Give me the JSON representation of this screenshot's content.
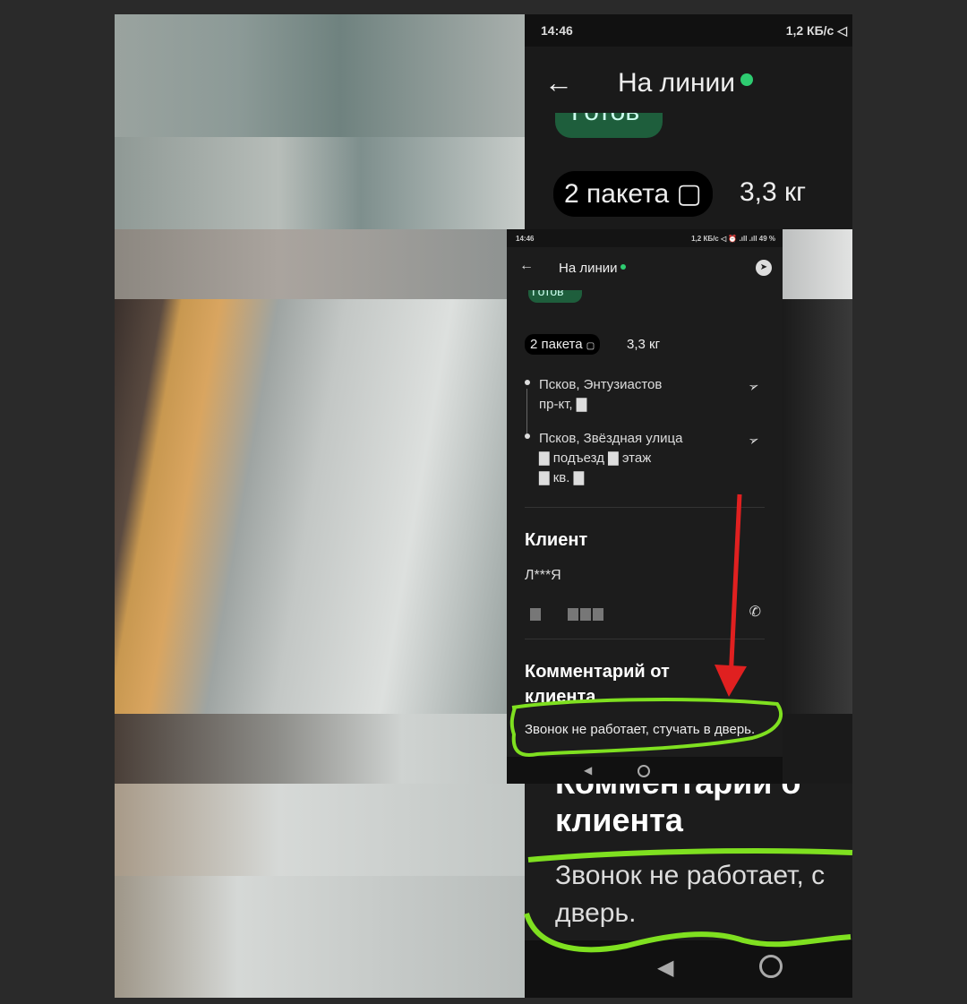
{
  "status_bar": {
    "time": "14:46",
    "right_large": "1,2 КБ/с ◁",
    "right_small": "1,2 КБ/с ◁ ⏰ .ıll .ıll 49 %"
  },
  "header": {
    "title": "На линии",
    "back_icon": "arrow-left-icon",
    "share_icon": "telegram-icon"
  },
  "order": {
    "status": "Готов",
    "packages": "2 пакета",
    "weight": "3,3 кг",
    "addresses": [
      {
        "line1": "Псков, Энтузиастов",
        "line2": "пр-кт, ▇"
      },
      {
        "line1": "Псков, Звёздная улица",
        "line2": "▇ подъезд ▇ этаж",
        "line3": "▇ кв. ▇"
      }
    ]
  },
  "client": {
    "section_title": "Клиент",
    "name": "Л***Я"
  },
  "comment": {
    "section_title_1": "Комментарий от",
    "section_title_2": "клиента",
    "zoom_title_1": "Комментарии о",
    "text": "Звонок не работает, стучать в дверь.",
    "zoom_text_1": "Звонок не работает, с",
    "zoom_text_2": "дверь."
  },
  "annotations": {
    "arrow_color": "#e02020",
    "highlight_color": "#7fe020"
  }
}
